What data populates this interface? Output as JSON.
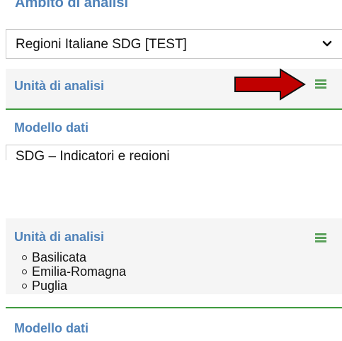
{
  "top": {
    "cut_title": "Ambito di analisi",
    "dropdown_value": "Regioni Italiane SDG [TEST]",
    "unit_section_title": "Unità di analisi",
    "model_section_title": "Modello dati",
    "cut_text": "SDG – Indicatori e regioni"
  },
  "bottom": {
    "unit_section_title": "Unità di analisi",
    "units": [
      "Basilicata",
      "Emilia-Romagna",
      "Puglia"
    ],
    "model_section_title": "Modello dati"
  },
  "icons": {
    "hamburger": "hamburger-menu-icon",
    "chevron": "chevron-down-icon",
    "arrow": "red-arrow-annotation"
  },
  "colors": {
    "section_title": "#4f82b9",
    "hamburger": "#5aa05a",
    "divider": "#3f9a3f",
    "arrow_fill": "#c00000"
  }
}
